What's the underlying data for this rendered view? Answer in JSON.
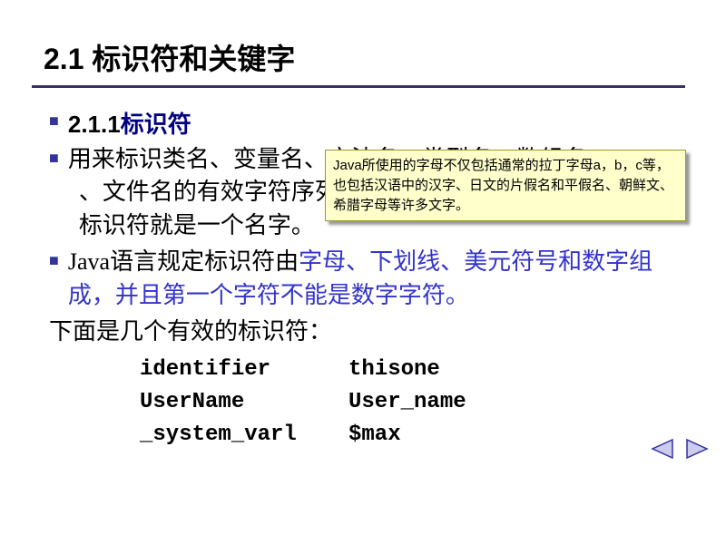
{
  "title": "2.1 标识符和关键字",
  "subtitle": {
    "number": "2.1.1",
    "text": "标识符"
  },
  "bullets": {
    "line1a": "用来标识类名、变量名、方法名、类型名、数组名",
    "line1b": "、文件名的有效字符序列称为标识符。简单地说，",
    "line1c": "标识符就是一个名字。",
    "line2a": "Java语言规定标识符由",
    "line2b": "字母、下划线、美元符号和数字组成，并且第一个字符不能是数字字符。"
  },
  "examples_intro": "下面是几个有效的标识符：",
  "examples": [
    [
      "identifier",
      "thisone"
    ],
    [
      "UserName",
      "User_name"
    ],
    [
      "_system_varl",
      " $max"
    ]
  ],
  "callout": "Java所使用的字母不仅包括通常的拉丁字母a，b，c等，也包括汉语中的汉字、日文的片假名和平假名、朝鲜文、希腊字母等许多文字。",
  "nav": {
    "prev": "prev",
    "next": "next"
  }
}
